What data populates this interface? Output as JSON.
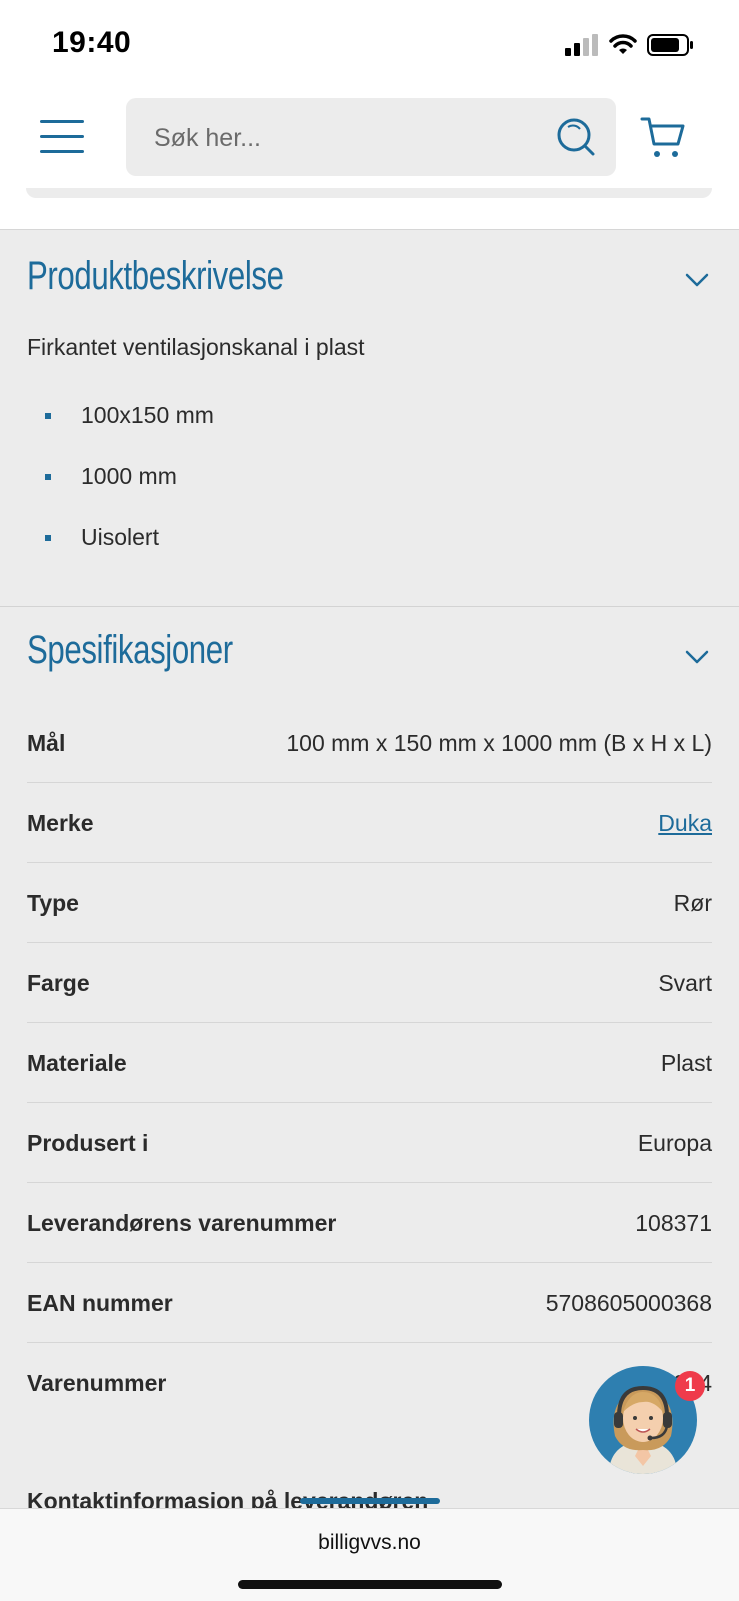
{
  "status_bar": {
    "time": "19:40"
  },
  "header": {
    "search_placeholder": "Søk her..."
  },
  "description": {
    "title": "Produktbeskrivelse",
    "text": "Firkantet ventilasjonskanal i plast",
    "bullets": [
      "100x150 mm",
      "1000 mm",
      "Uisolert"
    ]
  },
  "specifications": {
    "title": "Spesifikasjoner",
    "rows": [
      {
        "label": "Mål",
        "value": "100 mm x 150 mm x 1000 mm (B x H x L)"
      },
      {
        "label": "Merke",
        "value": "Duka"
      },
      {
        "label": "Type",
        "value": "Rør"
      },
      {
        "label": "Farge",
        "value": "Svart"
      },
      {
        "label": "Materiale",
        "value": "Plast"
      },
      {
        "label": "Produsert i",
        "value": "Europa"
      },
      {
        "label": "Leverandørens varenummer",
        "value": "108371"
      },
      {
        "label": "EAN nummer",
        "value": "5708605000368"
      },
      {
        "label": "Varenummer",
        "value": "197334"
      }
    ]
  },
  "contact_heading": "Kontaktinformasjon på leverandøren",
  "chat": {
    "badge_count": "1"
  },
  "browser": {
    "url": "billigvvs.no"
  },
  "colors": {
    "accent": "#1d6b9a",
    "background": "#ececec",
    "badge": "#ef3b4b"
  }
}
